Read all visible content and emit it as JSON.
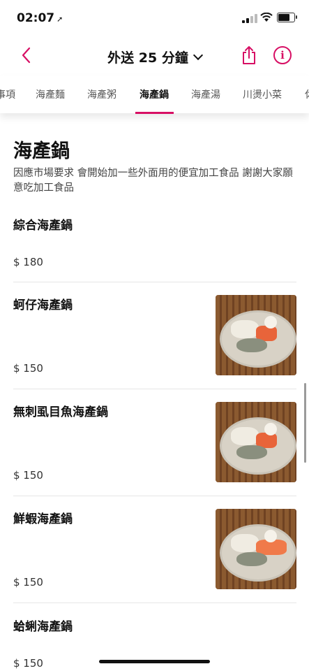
{
  "status_bar": {
    "time": "02:07"
  },
  "nav": {
    "title": "外送 25 分鐘"
  },
  "colors": {
    "accent": "#d70f64"
  },
  "tabs": [
    {
      "label": "事項"
    },
    {
      "label": "海產麵"
    },
    {
      "label": "海產粥"
    },
    {
      "label": "海產鍋",
      "active": true
    },
    {
      "label": "海產湯"
    },
    {
      "label": "川燙小菜"
    },
    {
      "label": "休"
    }
  ],
  "section": {
    "title": "海產鍋",
    "description": "因應市場要求 會開始加一些外面用的便宜加工食品 謝謝大家願意吃加工食品"
  },
  "items": [
    {
      "name": "綜合海產鍋",
      "price": "$ 180",
      "has_image": false
    },
    {
      "name": "蚵仔海產鍋",
      "price": "$ 150",
      "has_image": true
    },
    {
      "name": "無刺虱目魚海產鍋",
      "price": "$ 150",
      "has_image": true
    },
    {
      "name": "鮮蝦海產鍋",
      "price": "$ 150",
      "has_image": true
    },
    {
      "name": "蛤蜊海產鍋",
      "price": "$ 150",
      "has_image": false
    }
  ],
  "icons": [
    "location-arrow-icon",
    "signal-icon",
    "wifi-icon",
    "battery-icon",
    "back-chevron-icon",
    "chevron-down-icon",
    "share-icon",
    "info-icon"
  ]
}
